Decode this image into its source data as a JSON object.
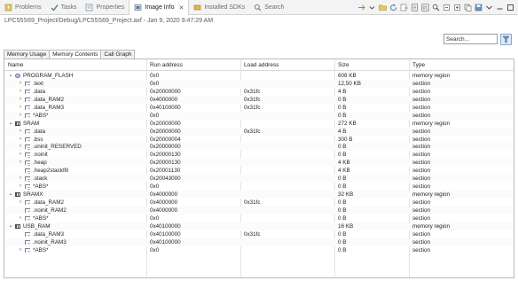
{
  "tabs": [
    {
      "label": "Problems",
      "icon": "problems-icon",
      "active": false
    },
    {
      "label": "Tasks",
      "icon": "tasks-icon",
      "active": false
    },
    {
      "label": "Properties",
      "icon": "properties-icon",
      "active": false
    },
    {
      "label": "Image Info",
      "icon": "image-info-icon",
      "active": true
    },
    {
      "label": "Installed SDKs",
      "icon": "sdk-icon",
      "active": false
    },
    {
      "label": "Search",
      "icon": "search-icon",
      "active": false
    }
  ],
  "path": "LPC55S69_Project/Debug/LPC55S69_Project.axf - Jan 9, 2020 9:47:29 AM",
  "search": {
    "placeholder": "Search..."
  },
  "subtabs": [
    "Memory Usage",
    "Memory Contents",
    "Call Graph"
  ],
  "active_subtab": 1,
  "columns": [
    "Name",
    "Run address",
    "Load address",
    "Size",
    "Type"
  ],
  "rows": [
    {
      "level": 0,
      "expand": "open",
      "icon": "flash",
      "name": "PROGRAM_FLASH",
      "run": "0x0",
      "load": "",
      "size": "608 KB",
      "type": "memory region"
    },
    {
      "level": 1,
      "expand": "closed",
      "icon": "section",
      "name": ".text",
      "run": "0x0",
      "load": "",
      "size": "12,50 KB",
      "type": "section"
    },
    {
      "level": 1,
      "expand": "closed",
      "icon": "section",
      "name": ".data",
      "run": "0x20000000",
      "load": "0x31fc",
      "size": "4 B",
      "type": "section"
    },
    {
      "level": 1,
      "expand": "closed",
      "icon": "section",
      "name": ".data_RAM2",
      "run": "0x4000000",
      "load": "0x31fc",
      "size": "0 B",
      "type": "section"
    },
    {
      "level": 1,
      "expand": "closed",
      "icon": "section",
      "name": ".data_RAM3",
      "run": "0x40100000",
      "load": "0x31fc",
      "size": "0 B",
      "type": "section"
    },
    {
      "level": 1,
      "expand": "closed",
      "icon": "section",
      "name": "*ABS*",
      "run": "0x0",
      "load": "",
      "size": "0 B",
      "type": "section"
    },
    {
      "level": 0,
      "expand": "open",
      "icon": "ram",
      "name": "SRAM",
      "run": "0x20000000",
      "load": "",
      "size": "272 KB",
      "type": "memory region"
    },
    {
      "level": 1,
      "expand": "closed",
      "icon": "section",
      "name": ".data",
      "run": "0x20000000",
      "load": "0x31fc",
      "size": "4 B",
      "type": "section"
    },
    {
      "level": 1,
      "expand": "closed",
      "icon": "section",
      "name": ".bss",
      "run": "0x20000004",
      "load": "",
      "size": "300 B",
      "type": "section"
    },
    {
      "level": 1,
      "expand": "closed",
      "icon": "section",
      "name": ".uninit_RESERVED",
      "run": "0x20000000",
      "load": "",
      "size": "0 B",
      "type": "section"
    },
    {
      "level": 1,
      "expand": "closed",
      "icon": "section",
      "name": ".noinit",
      "run": "0x20000130",
      "load": "",
      "size": "0 B",
      "type": "section"
    },
    {
      "level": 1,
      "expand": "closed",
      "icon": "section",
      "name": ".heap",
      "run": "0x20000130",
      "load": "",
      "size": "4 KB",
      "type": "section"
    },
    {
      "level": 1,
      "expand": "none",
      "icon": "section",
      "name": ".heap2stackfill",
      "run": "0x20001130",
      "load": "",
      "size": "4 KB",
      "type": "section"
    },
    {
      "level": 1,
      "expand": "closed",
      "icon": "section",
      "name": ".stack",
      "run": "0x20043000",
      "load": "",
      "size": "0 B",
      "type": "section"
    },
    {
      "level": 1,
      "expand": "closed",
      "icon": "section",
      "name": "*ABS*",
      "run": "0x0",
      "load": "",
      "size": "0 B",
      "type": "section"
    },
    {
      "level": 0,
      "expand": "open",
      "icon": "ram",
      "name": "SRAMX",
      "run": "0x4000000",
      "load": "",
      "size": "32 KB",
      "type": "memory region"
    },
    {
      "level": 1,
      "expand": "closed",
      "icon": "section",
      "name": ".data_RAM2",
      "run": "0x4000000",
      "load": "0x31fc",
      "size": "0 B",
      "type": "section"
    },
    {
      "level": 1,
      "expand": "none",
      "icon": "section",
      "name": ".noinit_RAM2",
      "run": "0x4000000",
      "load": "",
      "size": "0 B",
      "type": "section"
    },
    {
      "level": 1,
      "expand": "closed",
      "icon": "section",
      "name": "*ABS*",
      "run": "0x0",
      "load": "",
      "size": "0 B",
      "type": "section"
    },
    {
      "level": 0,
      "expand": "open",
      "icon": "ram",
      "name": "USB_RAM",
      "run": "0x40100000",
      "load": "",
      "size": "16 KB",
      "type": "memory region"
    },
    {
      "level": 1,
      "expand": "none",
      "icon": "section",
      "name": ".data_RAM3",
      "run": "0x40100000",
      "load": "0x31fc",
      "size": "0 B",
      "type": "section"
    },
    {
      "level": 1,
      "expand": "none",
      "icon": "section",
      "name": ".noinit_RAM3",
      "run": "0x40100000",
      "load": "",
      "size": "0 B",
      "type": "section"
    },
    {
      "level": 1,
      "expand": "closed",
      "icon": "section",
      "name": "*ABS*",
      "run": "0x0",
      "load": "",
      "size": "0 B",
      "type": "section"
    }
  ]
}
